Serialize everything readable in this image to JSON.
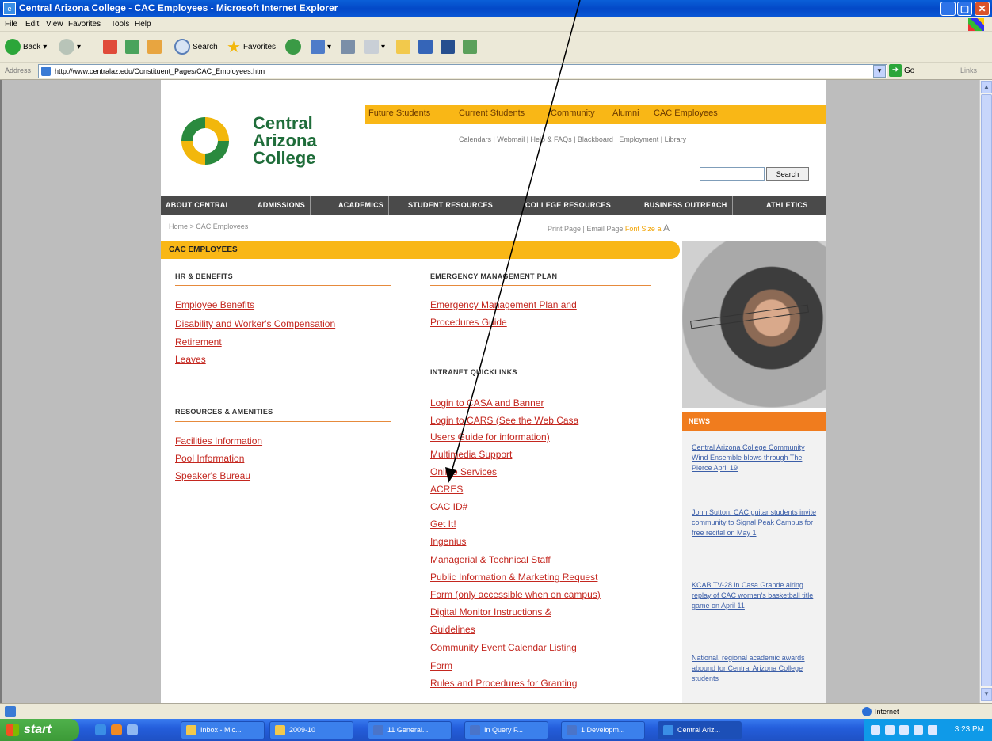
{
  "window": {
    "title": "Central Arizona College - CAC Employees - Microsoft Internet Explorer",
    "min": "_",
    "max": "▢",
    "close": "✕"
  },
  "menubar": [
    "File",
    "Edit",
    "View",
    "Favorites",
    "Tools",
    "Help"
  ],
  "toolbar": {
    "back": "Back",
    "search": "Search",
    "favorites": "Favorites"
  },
  "addressbar": {
    "label": "Address",
    "url": "http://www.centralaz.edu/Constituent_Pages/CAC_Employees.htm",
    "go": "Go",
    "links": "Links"
  },
  "site": {
    "logo": [
      "Central",
      "Arizona",
      "College"
    ],
    "top_nav": [
      "Future Students",
      "Current Students",
      "Community",
      "Alumni",
      "CAC Employees"
    ],
    "utility_links": "Calendars | Webmail | Help & FAQs | Blackboard | Employment | Library",
    "search_button": "Search",
    "main_nav": [
      "ABOUT CENTRAL",
      "ADMISSIONS",
      "ACADEMICS",
      "STUDENT RESOURCES",
      "COLLEGE RESOURCES",
      "BUSINESS OUTREACH",
      "ATHLETICS"
    ],
    "breadcrumb": "Home > CAC Employees",
    "page_tools": "Print Page | Email Page",
    "font_size_label": "Font Size",
    "font_size_small": "a",
    "font_size_large": "A",
    "section_title": "CAC EMPLOYEES"
  },
  "left_col": {
    "hr_heading": "HR & BENEFITS",
    "hr_links": [
      "Employee Benefits",
      "Disability and Worker's Compensation",
      "Retirement",
      "Leaves"
    ],
    "res_heading": "RESOURCES & AMENITIES",
    "res_links": [
      "Facilities Information",
      "Pool Information",
      "Speaker's Bureau"
    ]
  },
  "mid_col": {
    "emergency_heading": "EMERGENCY MANAGEMENT PLAN",
    "emergency_links": [
      "Emergency Management Plan and",
      "Procedures Guide"
    ],
    "intranet_heading": "INTRANET QUICKLINKS",
    "intranet_links": [
      "Login to CASA and Banner",
      "Login to CARS (See the Web Casa",
      "Users Guide for information)",
      "Multimedia Support",
      "Online Services",
      "ACRES",
      "CAC ID#",
      "Get It!",
      "Ingenius",
      "Managerial & Technical Staff",
      "Public Information & Marketing Request",
      "Form (only accessible when on campus)",
      "Digital Monitor Instructions &",
      "Guidelines",
      "Community Event Calendar Listing",
      "Form",
      "Rules and Procedures for Granting"
    ]
  },
  "news": {
    "title": "NEWS",
    "items": [
      "Central Arizona College Community Wind Ensemble blows through The Pierce April 19",
      "John Sutton, CAC guitar students invite community to Signal Peak Campus for free recital on May 1",
      "KCAB TV-28 in Casa Grande airing replay of CAC women's basketball title game on April 11",
      "National, regional academic awards abound for Central Arizona College students"
    ]
  },
  "statusbar": {
    "zone": "Internet"
  },
  "taskbar": {
    "start": "start",
    "tasks": [
      "Inbox - Mic...",
      "2009-10",
      "11 General...",
      "In Query F...",
      "1 Developm...",
      "Central Ariz..."
    ],
    "clock": "3:23 PM"
  },
  "colors": {
    "accent_gold": "#f9b716",
    "link_red": "#c4271f",
    "nav_dark": "#4a4a4a",
    "news_orange": "#f07c1e",
    "logo_green": "#1f6d3a"
  }
}
